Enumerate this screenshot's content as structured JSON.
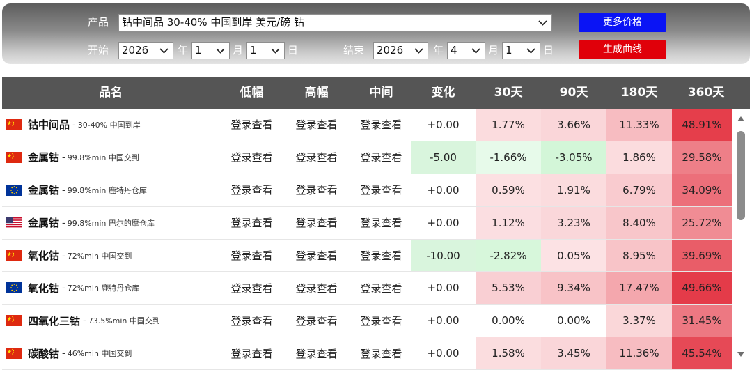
{
  "filters": {
    "product_label": "产品",
    "product_value": "钴中间品 30-40% 中国到岸 美元/磅 钴",
    "start_label": "开始",
    "end_label": "结束",
    "year_unit": "年",
    "month_unit": "月",
    "day_unit": "日",
    "start_year": "2026",
    "start_month": "1",
    "start_day": "1",
    "end_year": "2026",
    "end_month": "4",
    "end_day": "1",
    "more_prices_button": "更多价格",
    "generate_chart_button": "生成曲线",
    "more_prices_color": "#0a14f5",
    "generate_chart_color": "#e0000a"
  },
  "table": {
    "headers": [
      "品名",
      "低幅",
      "高幅",
      "中间",
      "变化",
      "30天",
      "90天",
      "180天",
      "360天"
    ],
    "login_text": "登录查看",
    "rows": [
      {
        "flag": "cn",
        "name": "钴中间品",
        "spec": "30-40% 中国到岸",
        "change": "+0.00",
        "d30": "1.77%",
        "d90": "3.66%",
        "d180": "11.33%",
        "d360": "48.91%"
      },
      {
        "flag": "cn",
        "name": "金属钴",
        "spec": "99.8%min 中国交到",
        "change": "-5.00",
        "d30": "-1.66%",
        "d90": "-3.05%",
        "d180": "1.86%",
        "d360": "29.58%"
      },
      {
        "flag": "eu",
        "name": "金属钴",
        "spec": "99.8%min 鹿特丹仓库",
        "change": "+0.00",
        "d30": "0.59%",
        "d90": "1.91%",
        "d180": "6.79%",
        "d360": "34.09%"
      },
      {
        "flag": "us",
        "name": "金属钴",
        "spec": "99.8%min 巴尔的摩仓库",
        "change": "+0.00",
        "d30": "1.12%",
        "d90": "3.23%",
        "d180": "8.40%",
        "d360": "25.72%"
      },
      {
        "flag": "cn",
        "name": "氧化钴",
        "spec": "72%min 中国交到",
        "change": "-10.00",
        "d30": "-2.82%",
        "d90": "0.05%",
        "d180": "8.95%",
        "d360": "39.69%"
      },
      {
        "flag": "eu",
        "name": "氧化钴",
        "spec": "72%min 鹿特丹仓库",
        "change": "+0.00",
        "d30": "5.53%",
        "d90": "9.34%",
        "d180": "17.47%",
        "d360": "49.66%"
      },
      {
        "flag": "cn",
        "name": "四氧化三钴",
        "spec": "73.5%min 中国交到",
        "change": "+0.00",
        "d30": "0.00%",
        "d90": "0.00%",
        "d180": "3.37%",
        "d360": "31.45%"
      },
      {
        "flag": "cn",
        "name": "碳酸钴",
        "spec": "46%min 中国交到",
        "change": "+0.00",
        "d30": "1.58%",
        "d90": "3.45%",
        "d180": "11.36%",
        "d360": "45.54%"
      }
    ]
  }
}
